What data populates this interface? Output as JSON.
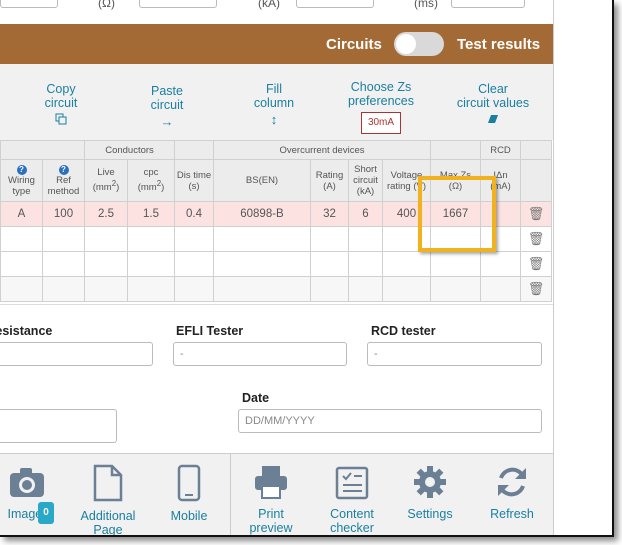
{
  "top": {
    "unit_ohm": "(Ω)",
    "unit_ka": "(kA)",
    "unit_ms": "(ms)"
  },
  "header_bar": {
    "circuits_label": "Circuits",
    "toggle_on": false,
    "test_results_label": "Test results",
    "color": "#a46a35"
  },
  "toolbar": {
    "copy": "Copy\ncircuit",
    "paste": "Paste\ncircuit",
    "fill": "Fill\ncolumn",
    "zs_pref": "Choose Zs\npreferences",
    "zs_value": "30mA",
    "clear": "Clear\ncircuit values"
  },
  "table": {
    "group_headers": {
      "conductors": "Conductors",
      "overcurrent": "Overcurrent devices",
      "rcd": "RCD"
    },
    "columns": {
      "wiring_type": "Wiring type",
      "ref_method": "Ref method",
      "live": "Live",
      "live_unit": "(mm",
      "cpc": "cpc",
      "cpc_unit": "(mm",
      "dis_time": "Dis time (s)",
      "bsen": "BS(EN)",
      "rating": "Rating (A)",
      "short_circuit": "Short circuit (kA)",
      "voltage_rating": "Voltage rating (V)",
      "max_zs": "Max Zs",
      "max_zs_unit": "(Ω)",
      "idn": "IΔn",
      "idn_unit": "(mA)"
    },
    "row": {
      "wiring_type": "A",
      "ref_method": "100",
      "live": "2.5",
      "cpc": "1.5",
      "dis_time": "0.4",
      "bsen": "60898-B",
      "rating": "32",
      "short_circuit": "6",
      "voltage": "400",
      "max_zs": "1667",
      "idn": ""
    }
  },
  "testers": {
    "insulation_label": "Insulation resistance",
    "efli_label": "EFLI Tester",
    "efli_value": "-",
    "rcd_label": "RCD tester",
    "rcd_value": "-",
    "date_label": "Date",
    "date_placeholder": "DD/MM/YYYY"
  },
  "bottom_bar": {
    "images": "Images",
    "images_count": "0",
    "additional_page": "Additional\nPage",
    "mobile": "Mobile",
    "print_preview": "Print\npreview",
    "content_checker": "Content\nchecker",
    "settings": "Settings",
    "refresh": "Refresh"
  }
}
